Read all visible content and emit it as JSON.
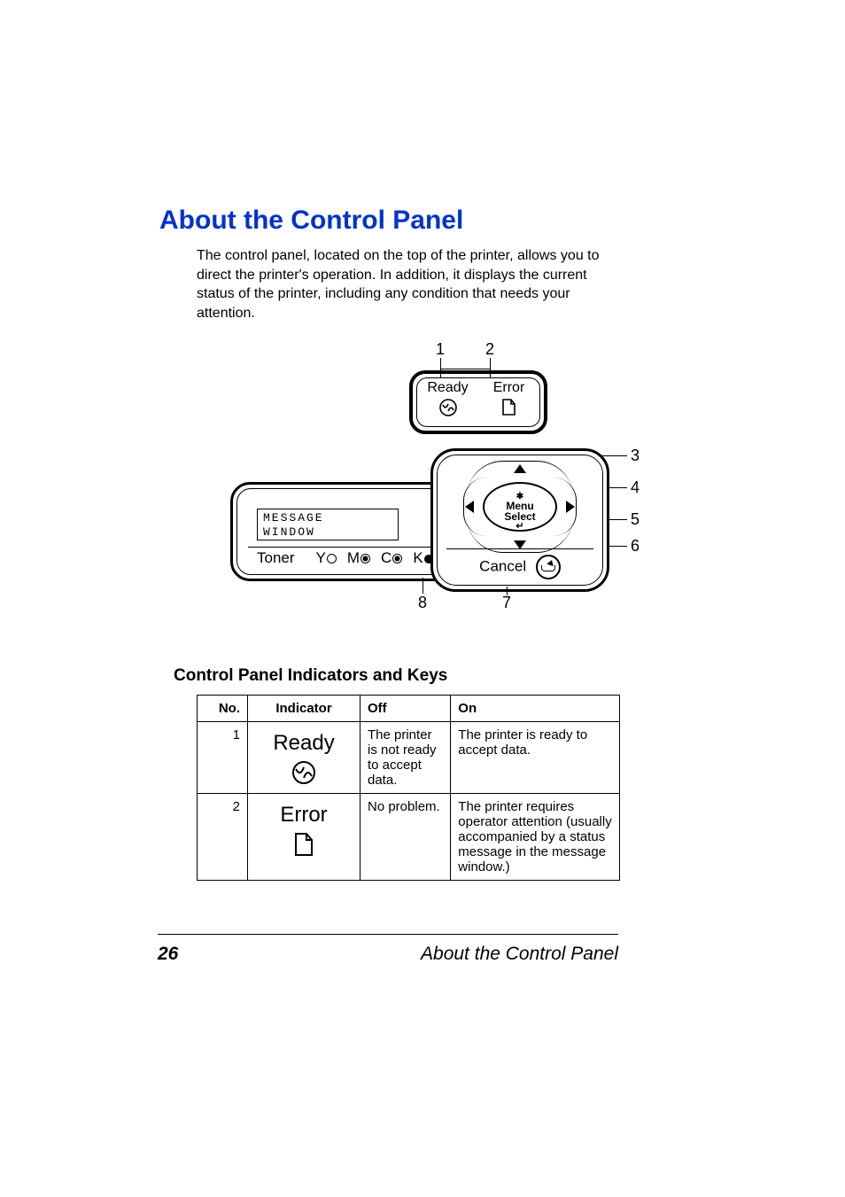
{
  "page": {
    "number": "26",
    "footer_title": "About the Control Panel"
  },
  "heading": "About the Control Panel",
  "intro": "The control panel, located on the top of the printer, allows you to direct the printer's operation. In addition, it displays the current status of the printer, including any condition that needs your attention.",
  "diagram": {
    "callouts": {
      "c1": "1",
      "c2": "2",
      "c3": "3",
      "c4": "4",
      "c5": "5",
      "c6": "6",
      "c7": "7",
      "c8": "8"
    },
    "indicator_panel": {
      "ready": "Ready",
      "error": "Error"
    },
    "message_window": "MESSAGE\nWINDOW",
    "toner": {
      "label": "Toner",
      "y": "Y",
      "m": "M",
      "c": "C",
      "k": "K"
    },
    "keypad": {
      "menu": "Menu",
      "select": "Select",
      "cancel": "Cancel"
    }
  },
  "section_heading": "Control Panel Indicators and Keys",
  "table": {
    "headers": {
      "no": "No.",
      "indicator": "Indicator",
      "off": "Off",
      "on": "On"
    },
    "rows": [
      {
        "no": "1",
        "indicator_label": "Ready",
        "off": "The printer is not ready to accept data.",
        "on": "The printer is ready to accept data."
      },
      {
        "no": "2",
        "indicator_label": "Error",
        "off": "No problem.",
        "on": "The printer requires operator attention (usually accompanied by a status message in the message window.)"
      }
    ]
  }
}
